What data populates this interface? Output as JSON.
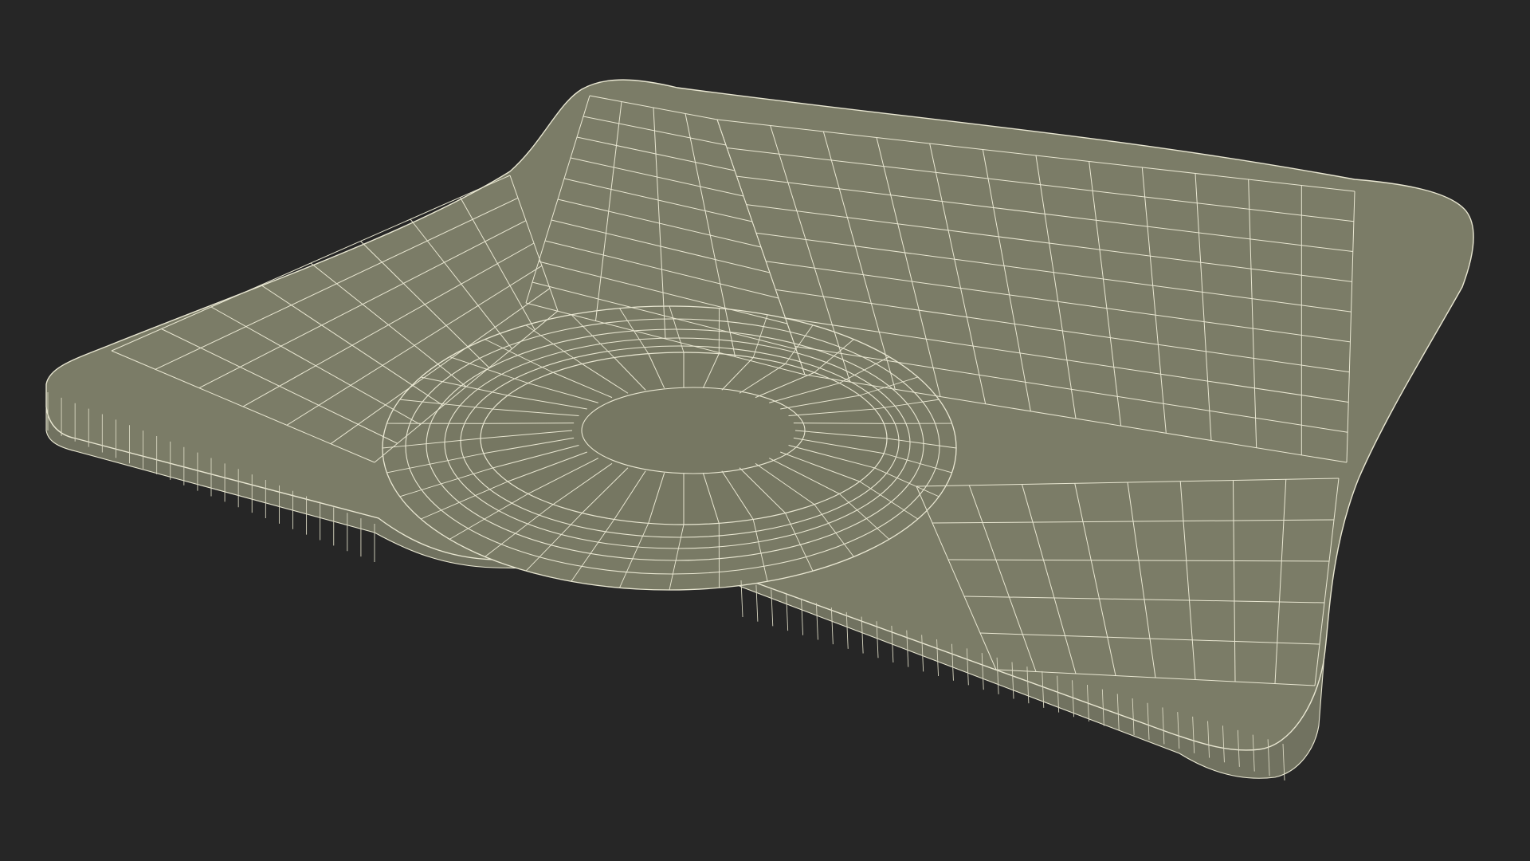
{
  "scene": {
    "subject": "wireframe-mesh",
    "colors": {
      "background": "#262626",
      "surface_top": "#7b7c67",
      "surface_inner": "#777863",
      "surface_side": "#737461",
      "wire": "#e9e7d2",
      "wire_soft": "#d9d7c1"
    }
  }
}
